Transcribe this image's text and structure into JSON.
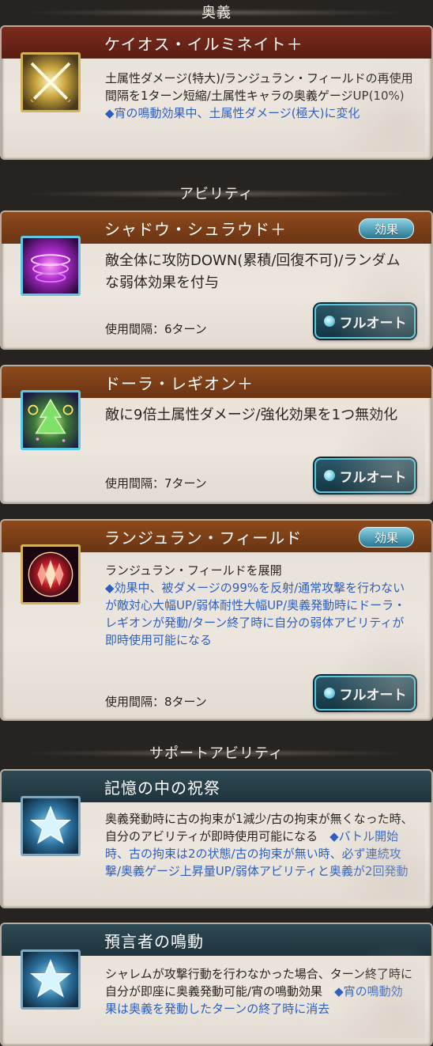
{
  "sections": {
    "ougi": "奥義",
    "ability": "アビリティ",
    "support": "サポートアビリティ"
  },
  "ougi": {
    "name": "ケイオス・イルミネイト＋",
    "icon": "crossed-swords-icon",
    "desc_part1": "土属性ダメージ(特大)/ランジュラン・フィールドの再使用間隔を1ターン短縮/土属性キャラの奥義ゲージUP(10%)",
    "desc_part2": "◆宵の鳴動効果中、土属性ダメージ(極大)に変化"
  },
  "abilities": [
    {
      "name": "シャドウ・シュラウド＋",
      "badge": "効果",
      "icon": "purple-vortex-icon",
      "desc": "敵全体に攻防DOWN(累積/回復不可)/ランダムな弱体効果を付与",
      "cooldown": "使用間隔：6ターン",
      "auto_label": "フルオート"
    },
    {
      "name": "ドーラ・レギオン＋",
      "badge": "",
      "icon": "green-tree-icon",
      "desc": "敵に9倍土属性ダメージ/強化効果を1つ無効化",
      "cooldown": "使用間隔：7ターン",
      "auto_label": "フルオート"
    },
    {
      "name": "ランジュラン・フィールド",
      "badge": "効果",
      "icon": "red-crystal-icon",
      "desc_part1": "ランジュラン・フィールドを展開",
      "desc_part2": "◆効果中、被ダメージの99%を反射/通常攻撃を行わないが敵対心大幅UP/弱体耐性大幅UP/奥義発動時にドーラ・レギオンが発動/ターン終了時に自分の弱体アビリティが即時使用可能になる",
      "cooldown": "使用間隔：8ターン",
      "auto_label": "フルオート"
    }
  ],
  "support": [
    {
      "name": "記憶の中の祝祭",
      "icon": "star-icon",
      "desc_part1": "奥義発動時に古の拘束が1減少/古の拘束が無くなった時、自分のアビリティが即時使用可能になる",
      "desc_part2": "◆バトル開始時、古の拘束は2の状態/古の拘束が無い時、必ず連続攻撃/奥義ゲージ上昇量UP/弱体アビリティと奥義が2回発動"
    },
    {
      "name": "預言者の鳴動",
      "icon": "star-icon",
      "desc_part1": "シャレムが攻撃行動を行わなかった場合、ターン終了時に自分が即座に奥義発動可能/宵の鳴動効果",
      "desc_part2": "◆宵の鳴動効果は奥義を発動したターンの終了時に消去"
    }
  ]
}
